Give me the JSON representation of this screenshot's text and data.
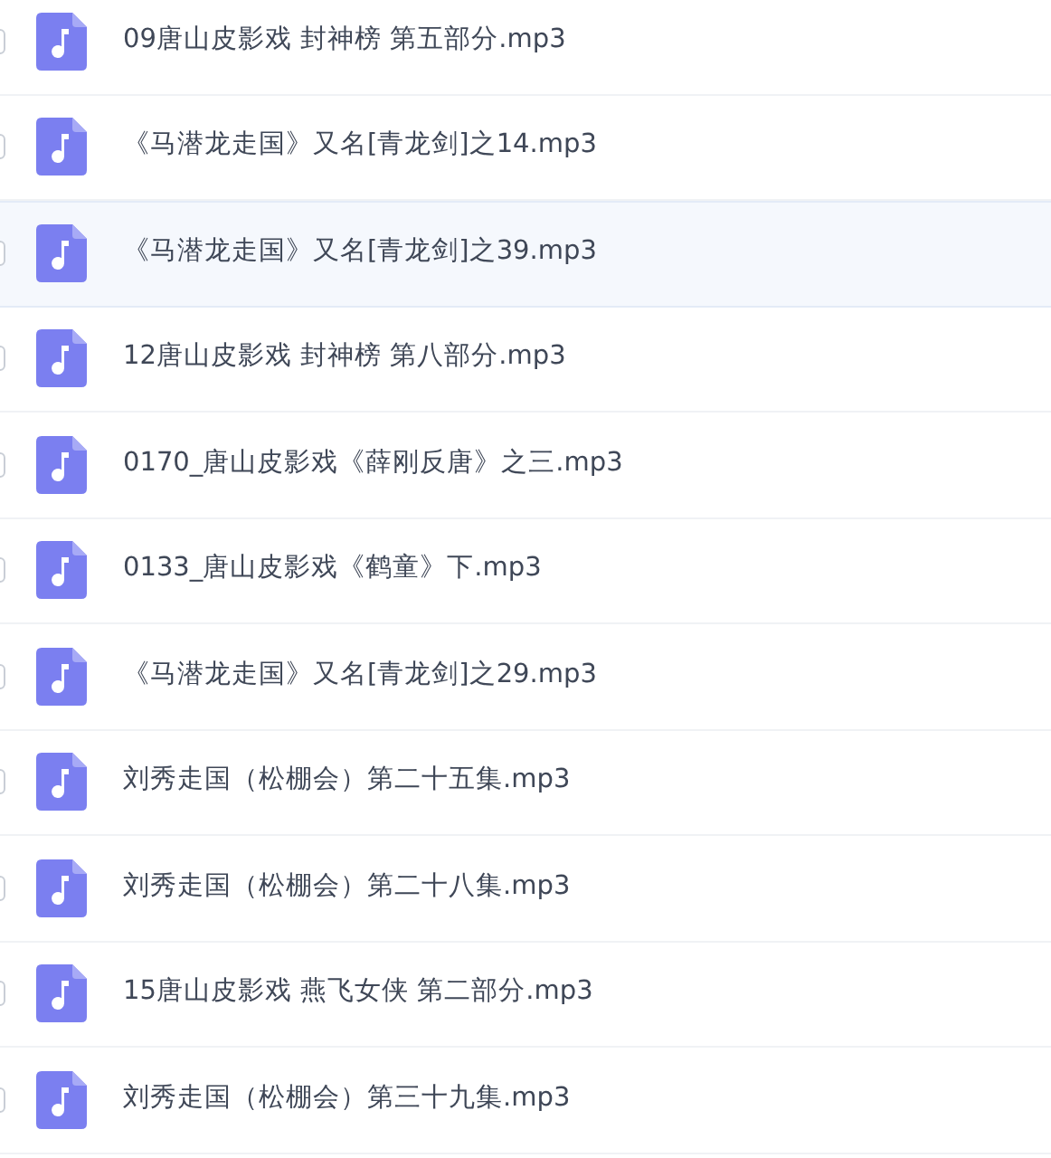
{
  "files": [
    {
      "name": "09唐山皮影戏 封神榜 第五部分.mp3",
      "checked": false,
      "selected": false
    },
    {
      "name": "《马潜龙走国》又名[青龙剑]之14.mp3",
      "checked": false,
      "selected": false
    },
    {
      "name": "《马潜龙走国》又名[青龙剑]之39.mp3",
      "checked": false,
      "selected": true
    },
    {
      "name": "12唐山皮影戏 封神榜 第八部分.mp3",
      "checked": false,
      "selected": false
    },
    {
      "name": "0170_唐山皮影戏《薛刚反唐》之三.mp3",
      "checked": false,
      "selected": false
    },
    {
      "name": "0133_唐山皮影戏《鹤童》下.mp3",
      "checked": false,
      "selected": false
    },
    {
      "name": "《马潜龙走国》又名[青龙剑]之29.mp3",
      "checked": false,
      "selected": false
    },
    {
      "name": "刘秀走国（松棚会）第二十五集.mp3",
      "checked": false,
      "selected": false
    },
    {
      "name": "刘秀走国（松棚会）第二十八集.mp3",
      "checked": false,
      "selected": false
    },
    {
      "name": "15唐山皮影戏 燕飞女侠 第二部分.mp3",
      "checked": false,
      "selected": false
    },
    {
      "name": "刘秀走国（松棚会）第三十九集.mp3",
      "checked": false,
      "selected": false
    }
  ]
}
